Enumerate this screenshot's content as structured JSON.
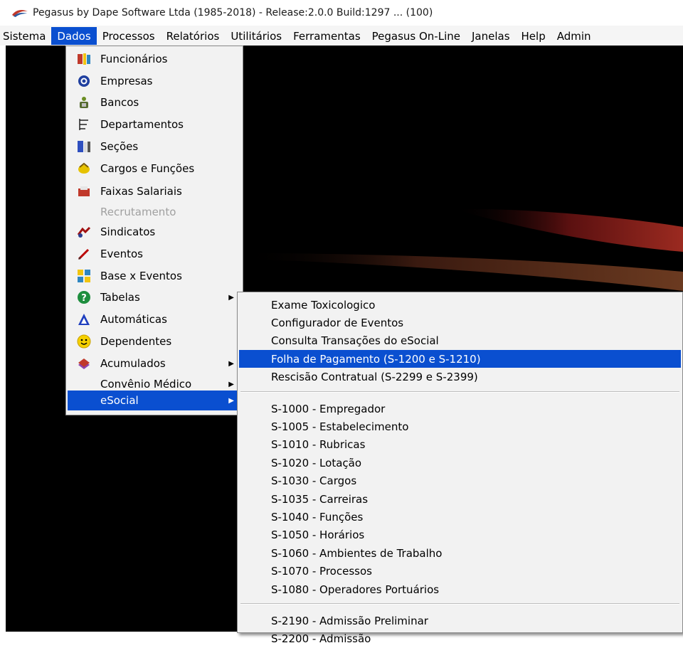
{
  "window": {
    "title": "Pegasus by Dape Software Ltda (1985-2018) - Release:2.0.0  Build:1297 ... (100)"
  },
  "menubar": [
    {
      "label": "Sistema",
      "active": false
    },
    {
      "label": "Dados",
      "active": true
    },
    {
      "label": "Processos",
      "active": false
    },
    {
      "label": "Relatórios",
      "active": false
    },
    {
      "label": "Utilitários",
      "active": false
    },
    {
      "label": "Ferramentas",
      "active": false
    },
    {
      "label": "Pegasus On-Line",
      "active": false
    },
    {
      "label": "Janelas",
      "active": false
    },
    {
      "label": "Help",
      "active": false
    },
    {
      "label": "Admin",
      "active": false
    }
  ],
  "dados_menu": [
    {
      "label": "Funcionários",
      "icon": "employees-icon"
    },
    {
      "label": "Empresas",
      "icon": "company-icon"
    },
    {
      "label": "Bancos",
      "icon": "bank-icon"
    },
    {
      "label": "Departamentos",
      "icon": "departments-icon"
    },
    {
      "label": "Seções",
      "icon": "sections-icon"
    },
    {
      "label": "Cargos e Funções",
      "icon": "positions-icon"
    },
    {
      "label": "Faixas Salariais",
      "icon": "salary-ranges-icon"
    },
    {
      "label": "Recrutamento",
      "icon": "",
      "disabled": true
    },
    {
      "label": "Sindicatos",
      "icon": "unions-icon"
    },
    {
      "label": "Eventos",
      "icon": "events-icon"
    },
    {
      "label": "Base x Eventos",
      "icon": "base-events-icon"
    },
    {
      "label": "Tabelas",
      "icon": "help-circle-icon",
      "submenu": true
    },
    {
      "label": "Automáticas",
      "icon": "automatic-icon"
    },
    {
      "label": "Dependentes",
      "icon": "smiley-icon"
    },
    {
      "label": "Acumulados",
      "icon": "books-icon",
      "submenu": true
    },
    {
      "label": "Convênio Médico",
      "icon": "",
      "submenu": true
    },
    {
      "label": "eSocial",
      "icon": "",
      "submenu": true,
      "active": true
    }
  ],
  "esocial_menu": [
    {
      "label": "Exame Toxicologico"
    },
    {
      "label": "Configurador de Eventos"
    },
    {
      "label": "Consulta Transações do eSocial"
    },
    {
      "label": "Folha de Pagamento (S-1200 e S-1210)",
      "active": true
    },
    {
      "label": "Rescisão Contratual (S-2299 e S-2399)"
    },
    {
      "separator": true
    },
    {
      "label": "S-1000 - Empregador"
    },
    {
      "label": "S-1005 - Estabelecimento"
    },
    {
      "label": "S-1010 - Rubricas"
    },
    {
      "label": "S-1020 - Lotação"
    },
    {
      "label": "S-1030 - Cargos"
    },
    {
      "label": "S-1035 - Carreiras"
    },
    {
      "label": "S-1040 - Funções"
    },
    {
      "label": "S-1050 - Horários"
    },
    {
      "label": "S-1060 - Ambientes de Trabalho"
    },
    {
      "label": "S-1070 - Processos"
    },
    {
      "label": "S-1080 - Operadores Portuários"
    },
    {
      "separator": true
    },
    {
      "label": "S-2190 - Admissão Preliminar"
    },
    {
      "label": "S-2200 - Admissão"
    }
  ],
  "colors": {
    "highlight": "#0a4fd0",
    "menu_bg": "#f2f2f2",
    "workspace": "#000000",
    "swoosh": "#8b1a1a"
  }
}
